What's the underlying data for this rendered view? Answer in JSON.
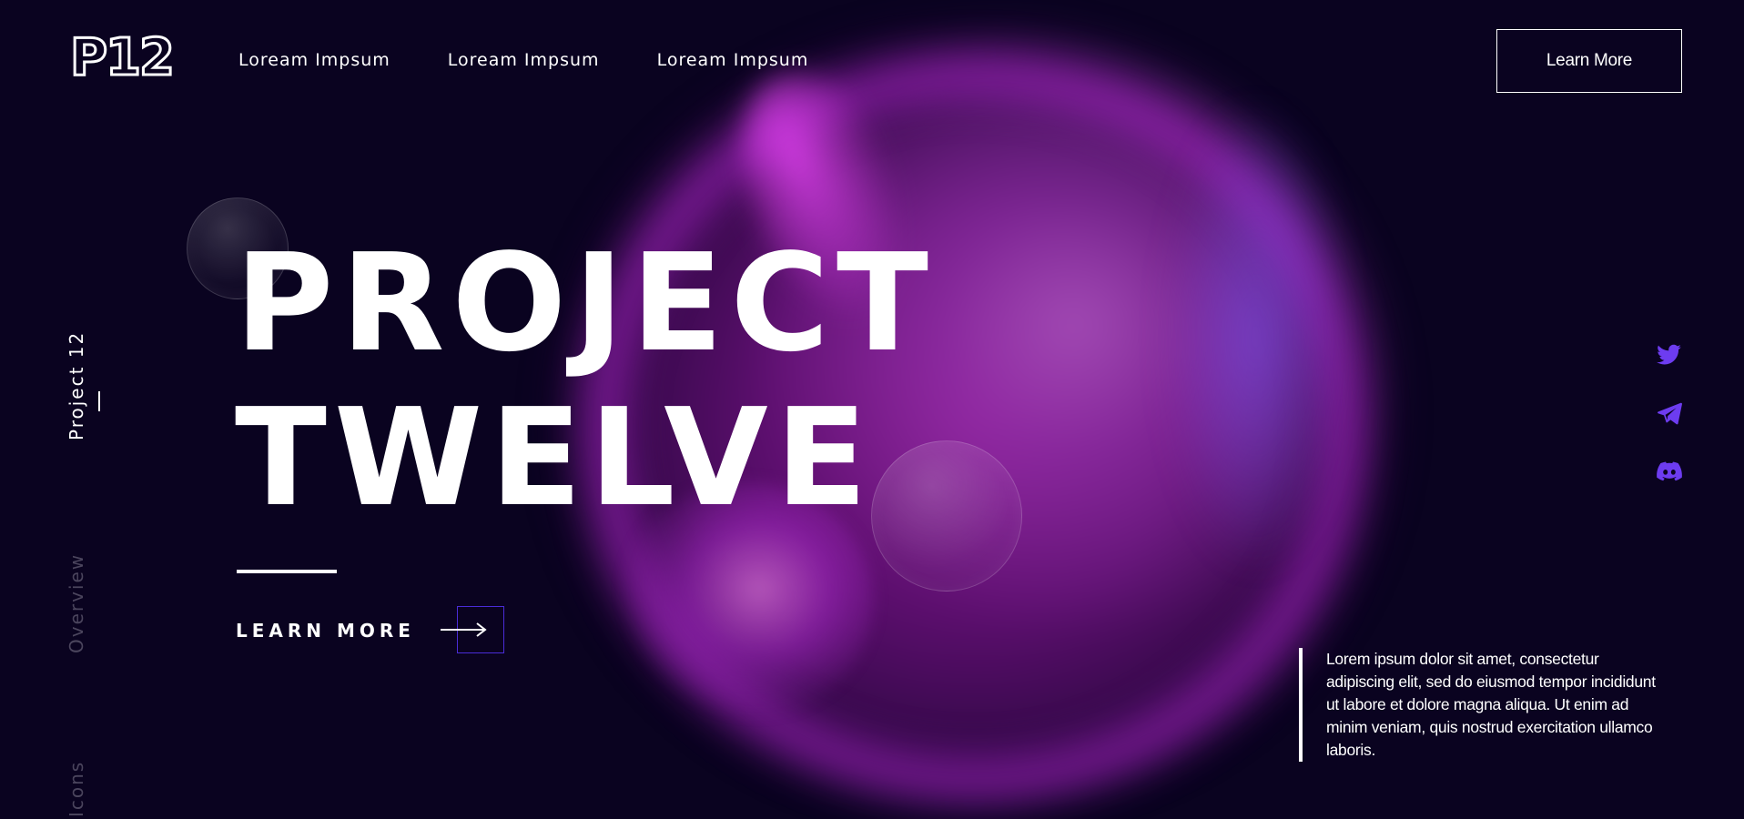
{
  "brand": {
    "logo_text": "P12"
  },
  "nav": {
    "links": [
      "Loream Impsum",
      "Loream Impsum",
      "Loream Impsum"
    ]
  },
  "header": {
    "cta_label": "Learn More"
  },
  "side_nav": {
    "items": [
      "Project 12",
      "Overview",
      "Icons"
    ]
  },
  "hero": {
    "line1": "PROJECT",
    "line2": "TWELVE",
    "cta_label": "LEARN MORE"
  },
  "socials": {
    "icons": [
      "twitter-icon",
      "telegram-icon",
      "discord-icon"
    ],
    "color": "#6d3cf0"
  },
  "description": {
    "text": "Lorem ipsum dolor sit amet, consectetur adipiscing elit, sed do eiusmod tempor incididunt ut labore et dolore magna aliqua. Ut enim ad minim veniam, quis nostrud exercitation ullamco laboris."
  },
  "colors": {
    "background": "#0a0320",
    "accent": "#6d3cf0",
    "cta_box": "#4a2cd8",
    "muted": "#4b455d"
  }
}
